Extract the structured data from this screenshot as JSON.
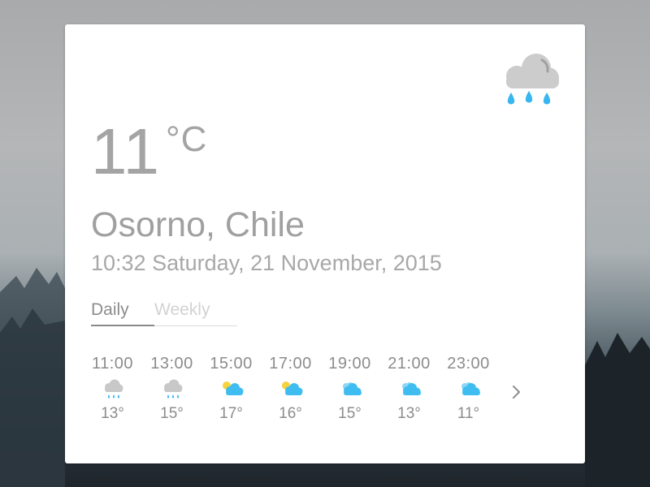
{
  "current": {
    "temperature": "11",
    "unit": "°C",
    "condition_icon": "rain-cloud-icon",
    "city": "Osorno, Chile",
    "datetime": "10:32 Saturday, 21 November, 2015"
  },
  "tabs": [
    {
      "label": "Daily",
      "active": true
    },
    {
      "label": "Weekly",
      "active": false
    }
  ],
  "hourly": [
    {
      "time": "11:00",
      "icon": "rain-icon",
      "temp": "13°"
    },
    {
      "time": "13:00",
      "icon": "rain-icon",
      "temp": "15°"
    },
    {
      "time": "15:00",
      "icon": "partly-sunny-icon",
      "temp": "17°"
    },
    {
      "time": "17:00",
      "icon": "partly-sunny-icon",
      "temp": "16°"
    },
    {
      "time": "19:00",
      "icon": "cloudy-icon",
      "temp": "15°"
    },
    {
      "time": "21:00",
      "icon": "cloudy-icon",
      "temp": "13°"
    },
    {
      "time": "23:00",
      "icon": "cloudy-icon",
      "temp": "11°"
    }
  ],
  "colors": {
    "rain_drop": "#38b6f0",
    "cloud_grey": "#c8c8c8",
    "cloud_blue": "#3fbdf0",
    "sun": "#f5d33c",
    "text": "#a4a4a4"
  }
}
